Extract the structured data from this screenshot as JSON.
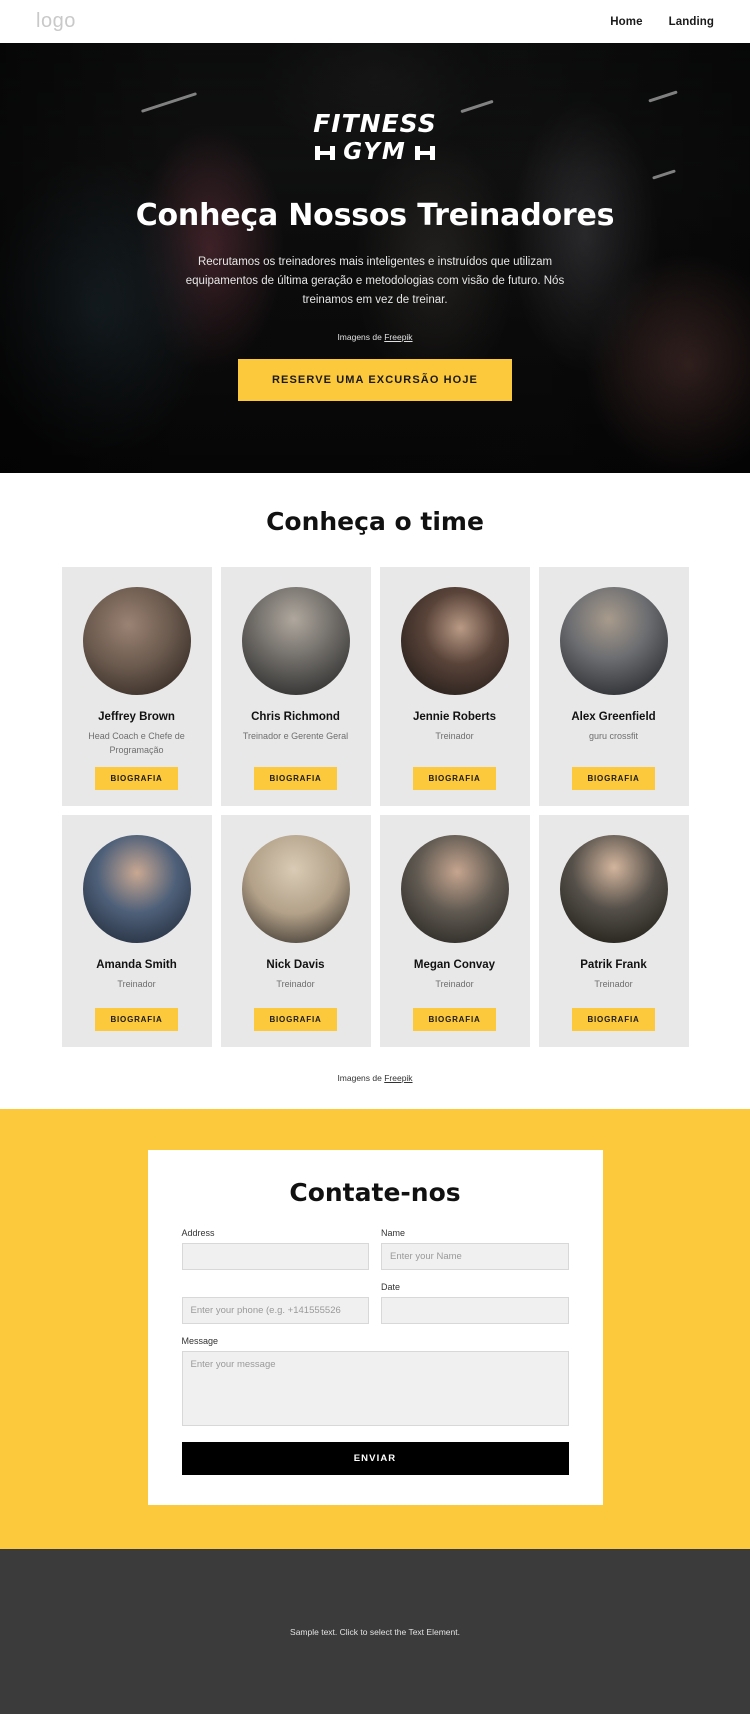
{
  "header": {
    "logo": "logo",
    "nav": [
      {
        "label": "Home"
      },
      {
        "label": "Landing"
      }
    ]
  },
  "hero": {
    "brand_line1": "FITNESS",
    "brand_line2": "GYM",
    "title": "Conheça Nossos Treinadores",
    "subtitle": "Recrutamos os treinadores mais inteligentes e instruídos que utilizam equipamentos de última geração e metodologias com visão de futuro. Nós treinamos em vez de treinar.",
    "credit_prefix": "Imagens de ",
    "credit_link": "Freepik",
    "cta_label": "RESERVE UMA EXCURSÃO HOJE",
    "accent_color": "#fcc83c"
  },
  "team": {
    "title": "Conheça o time",
    "bio_label": "BIOGRAFIA",
    "credit_prefix": "Imagens de ",
    "credit_link": "Freepik",
    "members": [
      {
        "name": "Jeffrey Brown",
        "role": "Head Coach e Chefe de Programação",
        "avatar_tone": "#6b5a4e"
      },
      {
        "name": "Chris Richmond",
        "role": "Treinador e Gerente Geral",
        "avatar_tone": "#4a4a4a"
      },
      {
        "name": "Jennie Roberts",
        "role": "Treinador",
        "avatar_tone": "#2b2320"
      },
      {
        "name": "Alex Greenfield",
        "role": "guru crossfit",
        "avatar_tone": "#6a7078"
      },
      {
        "name": "Amanda Smith",
        "role": "Treinador",
        "avatar_tone": "#3c4a62"
      },
      {
        "name": "Nick Davis",
        "role": "Treinador",
        "avatar_tone": "#b8a88e"
      },
      {
        "name": "Megan Convay",
        "role": "Treinador",
        "avatar_tone": "#4e4a44"
      },
      {
        "name": "Patrik Frank",
        "role": "Treinador",
        "avatar_tone": "#3a3834"
      }
    ]
  },
  "contact": {
    "title": "Contate-nos",
    "fields": {
      "address_label": "Address",
      "address_placeholder": "",
      "name_label": "Name",
      "name_placeholder": "Enter your Name",
      "phone_placeholder": "Enter your phone (e.g. +141555526",
      "date_label": "Date",
      "date_placeholder": "",
      "message_label": "Message",
      "message_placeholder": "Enter your message"
    },
    "submit_label": "ENVIAR",
    "background_color": "#fcc83c"
  },
  "footer": {
    "text": "Sample text. Click to select the Text Element."
  }
}
